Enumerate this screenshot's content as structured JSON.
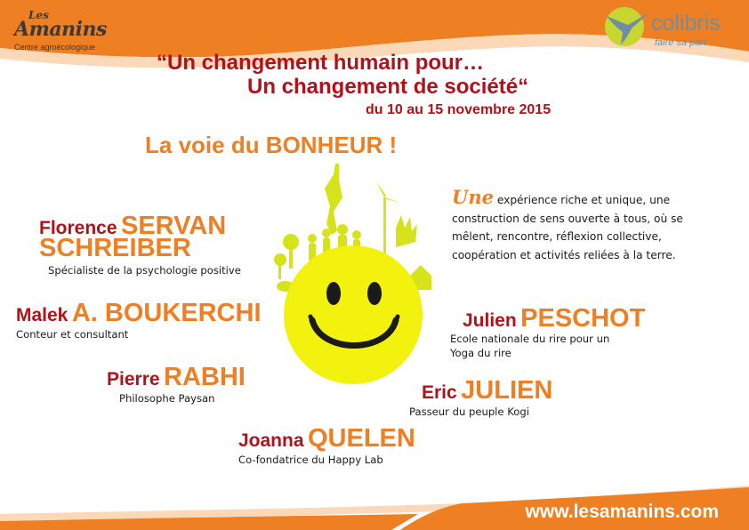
{
  "colors": {
    "orange": "#ee7f23",
    "red": "#b0121b",
    "sun": "#f2f20e",
    "text": "#1a1a1a"
  },
  "logo_left": {
    "small": "Les",
    "name": "Amanins",
    "tagline": "Centre agroécologique"
  },
  "logo_right": {
    "name": "colibris",
    "tagline": "faire sa part",
    "icon": "hummingbird-icon"
  },
  "title": {
    "line1": "“Un changement humain pour…",
    "line2": "Un changement de société“",
    "dates": "du 10 au 15 novembre 2015"
  },
  "headline": "La voie du BONHEUR  !",
  "description": {
    "lead": "Une",
    "text": "expérience riche et unique, une construction de sens ouverte à tous, où se mêlent, rencontre, réflexion collective, coopération et activités reliées à la terre."
  },
  "speakers": {
    "servan": {
      "first": "Florence",
      "last1": "SERVAN",
      "last2": "SCHREIBER",
      "role": "Spécialiste de la psychologie positive"
    },
    "boukerchi": {
      "first": "Malek",
      "last": "A. BOUKERCHI",
      "role": "Conteur et consultant"
    },
    "rabhi": {
      "first": "Pierre",
      "last": "RABHI",
      "role": "Philosophe Paysan"
    },
    "quelen": {
      "first": "Joanna",
      "last": "QUELEN",
      "role": "Co-fondatrice du Happy Lab"
    },
    "peschot": {
      "first": "Julien",
      "last": "PESCHOT",
      "role1": "Ecole nationale du rire pour un",
      "role2": "Yoga du rire"
    },
    "julien": {
      "first": "Eric",
      "last": "JULIEN",
      "role": "Passeur du peuple Kogi"
    }
  },
  "footer": {
    "url": "www.lesamanins.com"
  }
}
